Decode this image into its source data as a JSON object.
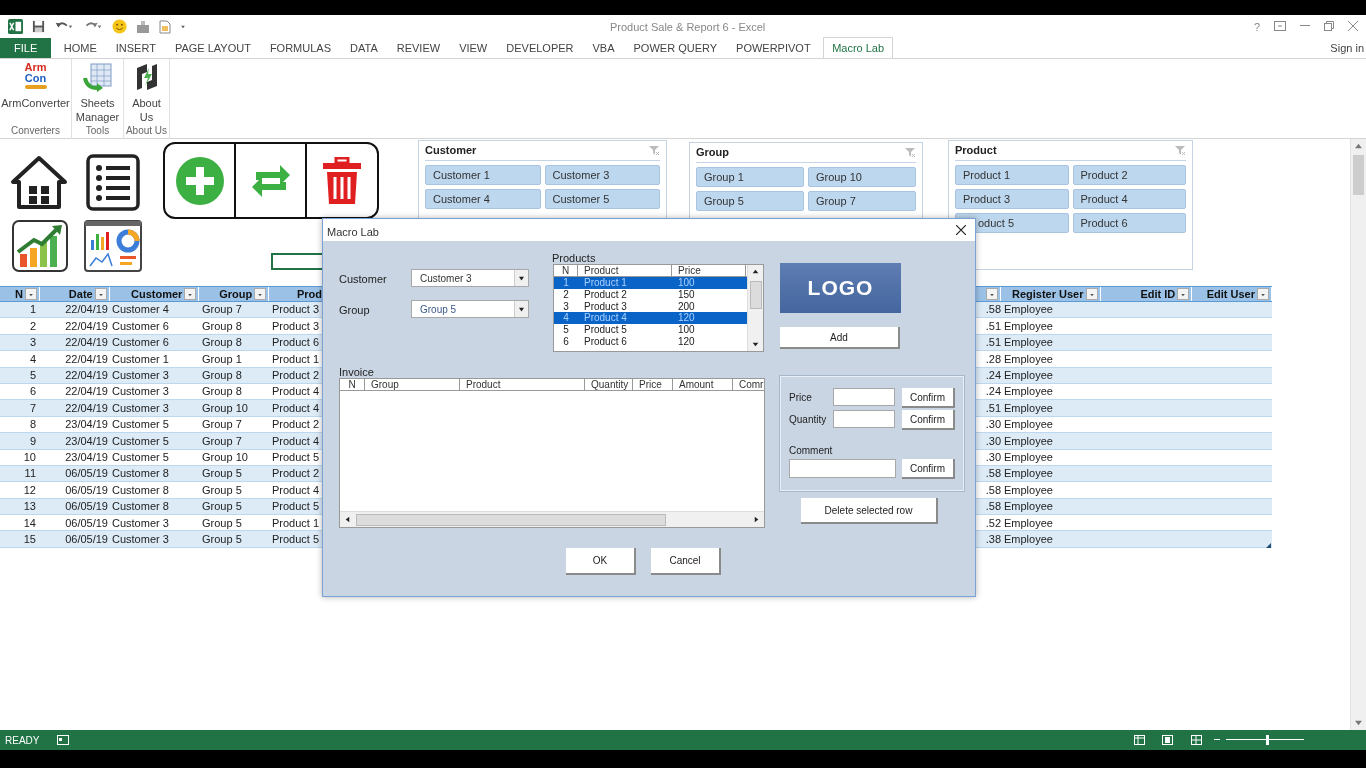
{
  "window": {
    "title": "Product Sale & Report 6 - Excel",
    "help": "?"
  },
  "ribbon_tabs": [
    {
      "label": "FILE",
      "kind": "file",
      "selected": false
    },
    {
      "label": "HOME",
      "selected": false
    },
    {
      "label": "INSERT",
      "selected": false
    },
    {
      "label": "PAGE LAYOUT",
      "selected": false
    },
    {
      "label": "FORMULAS",
      "selected": false
    },
    {
      "label": "DATA",
      "selected": false
    },
    {
      "label": "REVIEW",
      "selected": false
    },
    {
      "label": "VIEW",
      "selected": false
    },
    {
      "label": "DEVELOPER",
      "selected": false
    },
    {
      "label": "VBA",
      "selected": false
    },
    {
      "label": "POWER QUERY",
      "selected": false
    },
    {
      "label": "POWERPIVOT",
      "selected": false
    },
    {
      "label": "Macro Lab",
      "selected": true
    }
  ],
  "sign_in": "Sign in",
  "ribbon_groups": [
    {
      "label": "Converters",
      "button": {
        "label": "ArmConverter",
        "kind": "armcon",
        "logo_text": [
          "Arm",
          "Con"
        ]
      }
    },
    {
      "label": "Tools",
      "button": {
        "label": "Sheets Manager",
        "kind": "sheets"
      }
    },
    {
      "label": "About Us",
      "button": {
        "label": "About Us",
        "kind": "about"
      }
    }
  ],
  "slicers": [
    {
      "title": "Customer",
      "items": [
        {
          "label": "Customer 1"
        },
        {
          "label": "Customer 3"
        },
        {
          "label": "Customer 4"
        },
        {
          "label": "Customer 5"
        }
      ]
    },
    {
      "title": "Group",
      "items": [
        {
          "label": "Group 1"
        },
        {
          "label": "Group 10"
        },
        {
          "label": "Group 5"
        },
        {
          "label": "Group 7"
        }
      ]
    },
    {
      "title": "Product",
      "items": [
        {
          "label": "Product 1"
        },
        {
          "label": "Product 2"
        },
        {
          "label": "Product 3"
        },
        {
          "label": "Product 4"
        },
        {
          "label": "oduct 5",
          "clipped": true
        },
        {
          "label": "Product 6"
        }
      ]
    }
  ],
  "table": {
    "left_columns": [
      "N",
      "Date",
      "Customer",
      "Group",
      "Prod"
    ],
    "right_columns": [
      "Register User",
      "Edit ID",
      "Edit User"
    ],
    "rows": [
      {
        "n": "1",
        "date": "22/04/19",
        "customer": "Customer 4",
        "group": "Group 7",
        "product": "Product 3",
        "amount": ".58",
        "register_user": "Employee"
      },
      {
        "n": "2",
        "date": "22/04/19",
        "customer": "Customer 6",
        "group": "Group 8",
        "product": "Product 3",
        "amount": ".51",
        "register_user": "Employee"
      },
      {
        "n": "3",
        "date": "22/04/19",
        "customer": "Customer 6",
        "group": "Group 8",
        "product": "Product 6",
        "amount": ".51",
        "register_user": "Employee"
      },
      {
        "n": "4",
        "date": "22/04/19",
        "customer": "Customer 1",
        "group": "Group 1",
        "product": "Product 1",
        "amount": ".28",
        "register_user": "Employee"
      },
      {
        "n": "5",
        "date": "22/04/19",
        "customer": "Customer 3",
        "group": "Group 8",
        "product": "Product 2",
        "amount": ".24",
        "register_user": "Employee"
      },
      {
        "n": "6",
        "date": "22/04/19",
        "customer": "Customer 3",
        "group": "Group 8",
        "product": "Product 4",
        "amount": ".24",
        "register_user": "Employee"
      },
      {
        "n": "7",
        "date": "22/04/19",
        "customer": "Customer 3",
        "group": "Group 10",
        "product": "Product 4",
        "amount": ".51",
        "register_user": "Employee"
      },
      {
        "n": "8",
        "date": "23/04/19",
        "customer": "Customer 5",
        "group": "Group 7",
        "product": "Product 2",
        "amount": ".30",
        "register_user": "Employee"
      },
      {
        "n": "9",
        "date": "23/04/19",
        "customer": "Customer 5",
        "group": "Group 7",
        "product": "Product 4",
        "amount": ".30",
        "register_user": "Employee"
      },
      {
        "n": "10",
        "date": "23/04/19",
        "customer": "Customer 5",
        "group": "Group 10",
        "product": "Product 5",
        "amount": ".30",
        "register_user": "Employee"
      },
      {
        "n": "11",
        "date": "06/05/19",
        "customer": "Customer 8",
        "group": "Group 5",
        "product": "Product 2",
        "amount": ".58",
        "register_user": "Employee"
      },
      {
        "n": "12",
        "date": "06/05/19",
        "customer": "Customer 8",
        "group": "Group 5",
        "product": "Product 4",
        "amount": ".58",
        "register_user": "Employee"
      },
      {
        "n": "13",
        "date": "06/05/19",
        "customer": "Customer 8",
        "group": "Group 5",
        "product": "Product 5",
        "amount": ".58",
        "register_user": "Employee"
      },
      {
        "n": "14",
        "date": "06/05/19",
        "customer": "Customer 3",
        "group": "Group 5",
        "product": "Product 1",
        "amount": ".52",
        "register_user": "Employee"
      },
      {
        "n": "15",
        "date": "06/05/19",
        "customer": "Customer 3",
        "group": "Group 5",
        "product": "Product 5",
        "amount": ".38",
        "register_user": "Employee"
      }
    ]
  },
  "dialog": {
    "title": "Macro Lab",
    "customer": {
      "label": "Customer",
      "value": "Customer 3"
    },
    "group": {
      "label": "Group",
      "value": "Group 5"
    },
    "products": {
      "label": "Products",
      "columns": [
        "N",
        "Product",
        "Price"
      ],
      "rows": [
        {
          "n": "1",
          "product": "Product 1",
          "price": "100",
          "selected": true
        },
        {
          "n": "2",
          "product": "Product 2",
          "price": "150",
          "selected": false
        },
        {
          "n": "3",
          "product": "Product 3",
          "price": "200",
          "selected": false
        },
        {
          "n": "4",
          "product": "Product 4",
          "price": "120",
          "selected": true
        },
        {
          "n": "5",
          "product": "Product 5",
          "price": "100",
          "selected": false
        },
        {
          "n": "6",
          "product": "Product 6",
          "price": "120",
          "selected": false
        }
      ]
    },
    "logo": "LOGO",
    "add_button": "Add",
    "invoice": {
      "label": "Invoice",
      "columns": [
        "N",
        "Group",
        "Product",
        "Quantity",
        "Price",
        "Amount",
        "Comr"
      ]
    },
    "edit_fields": [
      {
        "label": "Price",
        "button": "Confirm"
      },
      {
        "label": "Quantity",
        "button": "Confirm"
      },
      {
        "label": "Comment",
        "button": "Confirm",
        "kind": "below"
      }
    ],
    "delete_button": "Delete selected row",
    "ok_button": "OK",
    "cancel_button": "Cancel"
  },
  "status_bar": {
    "mode": "READY",
    "zoom": {
      "level": 0.52
    }
  }
}
